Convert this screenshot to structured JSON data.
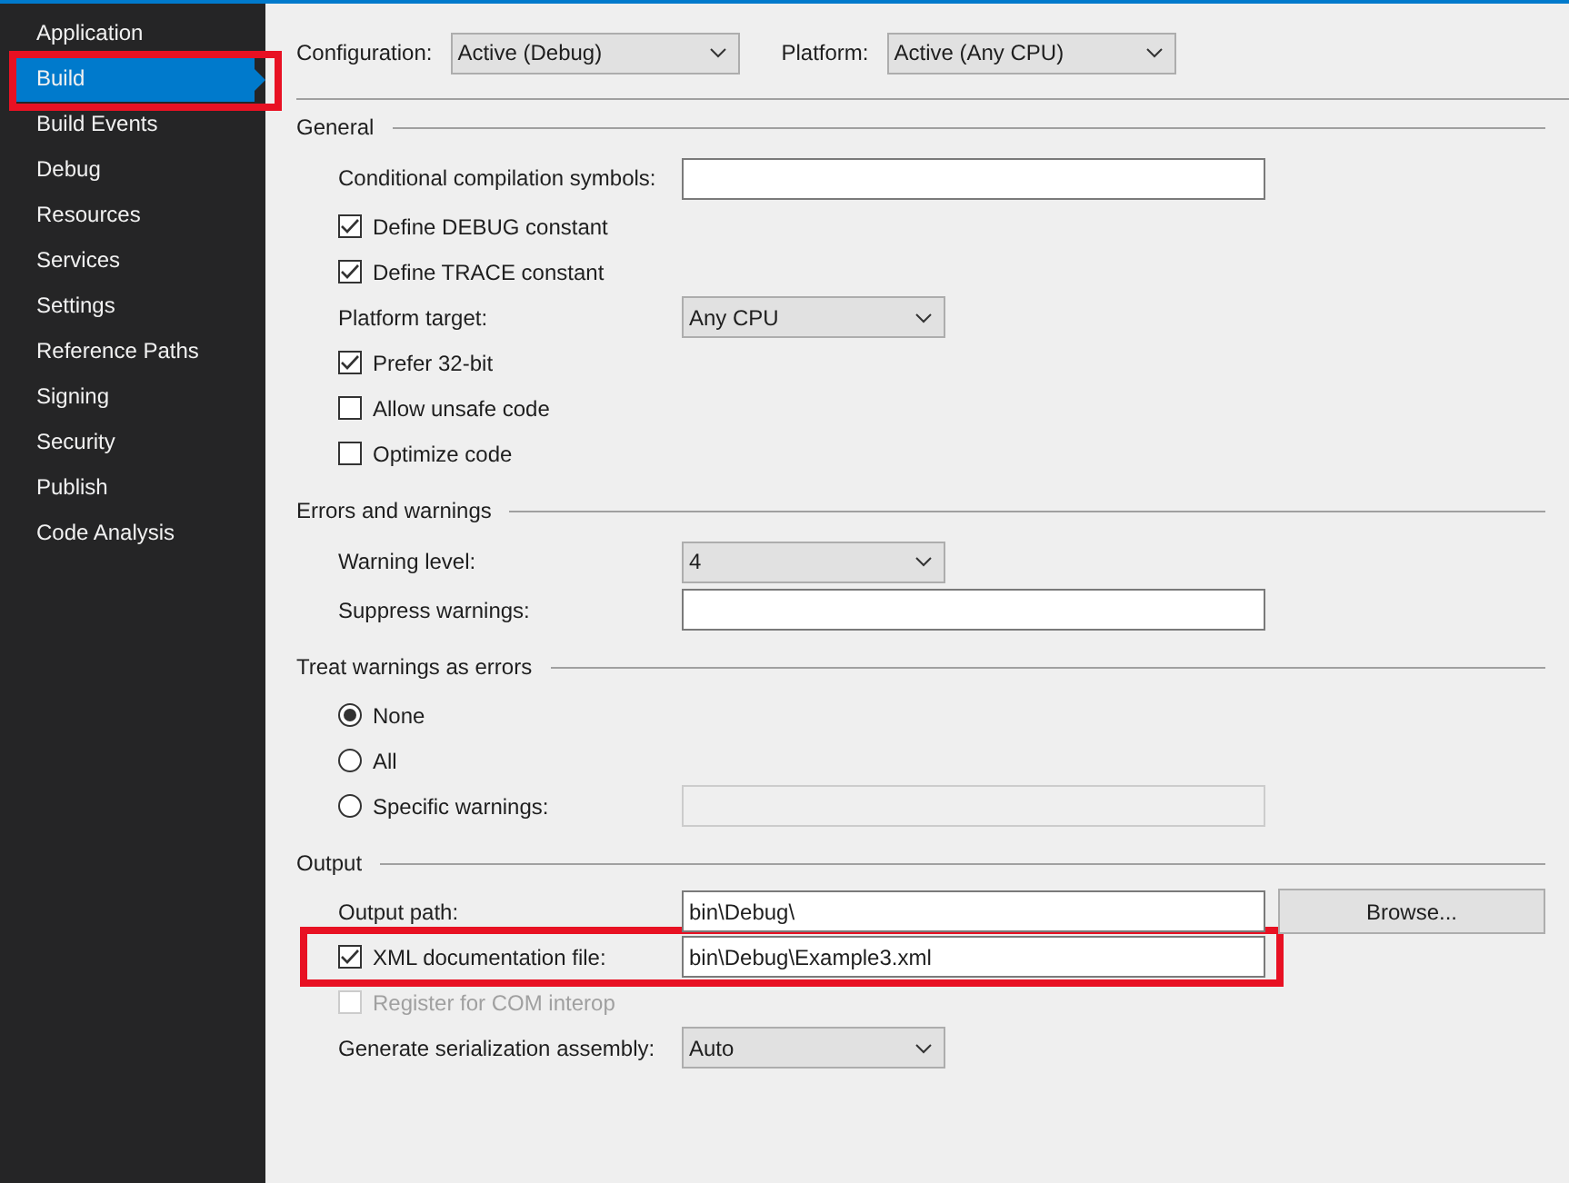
{
  "sidebar": {
    "items": [
      {
        "label": "Application",
        "selected": false,
        "highlighted": false
      },
      {
        "label": "Build",
        "selected": true,
        "highlighted": true
      },
      {
        "label": "Build Events",
        "selected": false,
        "highlighted": false
      },
      {
        "label": "Debug",
        "selected": false,
        "highlighted": false
      },
      {
        "label": "Resources",
        "selected": false,
        "highlighted": false
      },
      {
        "label": "Services",
        "selected": false,
        "highlighted": false
      },
      {
        "label": "Settings",
        "selected": false,
        "highlighted": false
      },
      {
        "label": "Reference Paths",
        "selected": false,
        "highlighted": false
      },
      {
        "label": "Signing",
        "selected": false,
        "highlighted": false
      },
      {
        "label": "Security",
        "selected": false,
        "highlighted": false
      },
      {
        "label": "Publish",
        "selected": false,
        "highlighted": false
      },
      {
        "label": "Code Analysis",
        "selected": false,
        "highlighted": false
      }
    ]
  },
  "configuration": {
    "label": "Configuration:",
    "value": "Active (Debug)"
  },
  "platform": {
    "label": "Platform:",
    "value": "Active (Any CPU)"
  },
  "sections": [
    {
      "title": "General",
      "rows": [
        {
          "kind": "text",
          "label": "Conditional compilation symbols:",
          "value": ""
        },
        {
          "kind": "checkbox",
          "label": "Define DEBUG constant",
          "checked": true,
          "disabled": false
        },
        {
          "kind": "checkbox",
          "label": "Define TRACE constant",
          "checked": true,
          "disabled": false
        },
        {
          "kind": "dropdown",
          "label": "Platform target:",
          "value": "Any CPU"
        },
        {
          "kind": "checkbox",
          "label": "Prefer 32-bit",
          "checked": true,
          "disabled": false
        },
        {
          "kind": "checkbox",
          "label": "Allow unsafe code",
          "checked": false,
          "disabled": false
        },
        {
          "kind": "checkbox",
          "label": "Optimize code",
          "checked": false,
          "disabled": false
        }
      ]
    },
    {
      "title": "Errors and warnings",
      "rows": [
        {
          "kind": "dropdown",
          "label": "Warning level:",
          "value": "4"
        },
        {
          "kind": "text",
          "label": "Suppress warnings:",
          "value": ""
        }
      ]
    },
    {
      "title": "Treat warnings as errors",
      "rows": [
        {
          "kind": "radio",
          "label": "None",
          "selected": true
        },
        {
          "kind": "radio",
          "label": "All",
          "selected": false
        },
        {
          "kind": "radio",
          "label": "Specific warnings:",
          "selected": false,
          "field_disabled": true
        }
      ]
    },
    {
      "title": "Output",
      "rows": [
        {
          "kind": "text",
          "label": "Output path:",
          "value": "bin\\Debug\\",
          "button": "Browse..."
        },
        {
          "kind": "checkfield",
          "label": "XML documentation file:",
          "checked": true,
          "value": "bin\\Debug\\Example3.xml",
          "highlighted": true
        },
        {
          "kind": "checkbox",
          "label": "Register for COM interop",
          "checked": false,
          "disabled": true
        },
        {
          "kind": "dropdown",
          "label": "Generate serialization assembly:",
          "value": "Auto"
        }
      ]
    }
  ]
}
